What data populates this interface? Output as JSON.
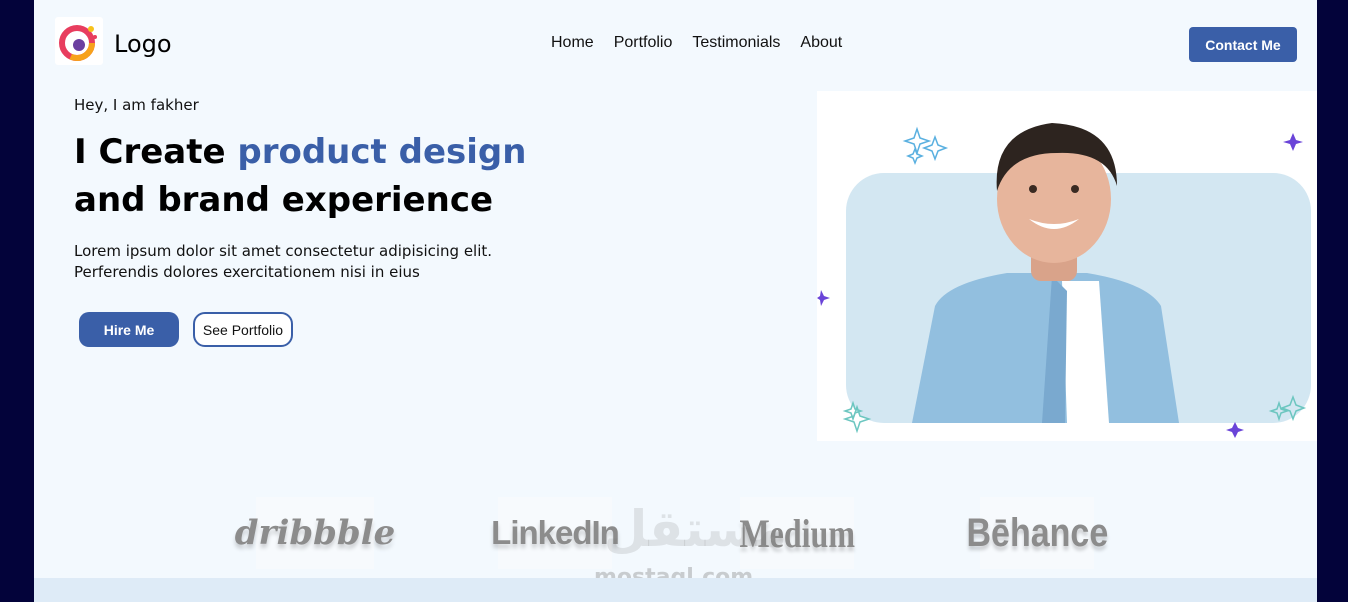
{
  "header": {
    "logo_text": "Logo",
    "nav": [
      "Home",
      "Portfolio",
      "Testimonials",
      "About"
    ],
    "contact_label": "Contact Me"
  },
  "hero": {
    "greeting": "Hey, I am fakher",
    "headline_prefix": "I Create ",
    "headline_accent": "product design",
    "headline_line2": "and brand experience",
    "description_line1": "Lorem ipsum dolor sit amet consectetur adipisicing elit.",
    "description_line2": "Perferendis dolores exercitationem nisi in eius",
    "hire_label": "Hire Me",
    "portfolio_label": "See Portfolio"
  },
  "brands": [
    "dribbble",
    "LinkedIn",
    "Medium",
    "Bēhance"
  ],
  "watermark": "mostaql.com",
  "watermark_ar": "مستقل",
  "colors": {
    "accent": "#3a5fa8",
    "background": "#f3f9fe",
    "frame": "#03033a"
  }
}
